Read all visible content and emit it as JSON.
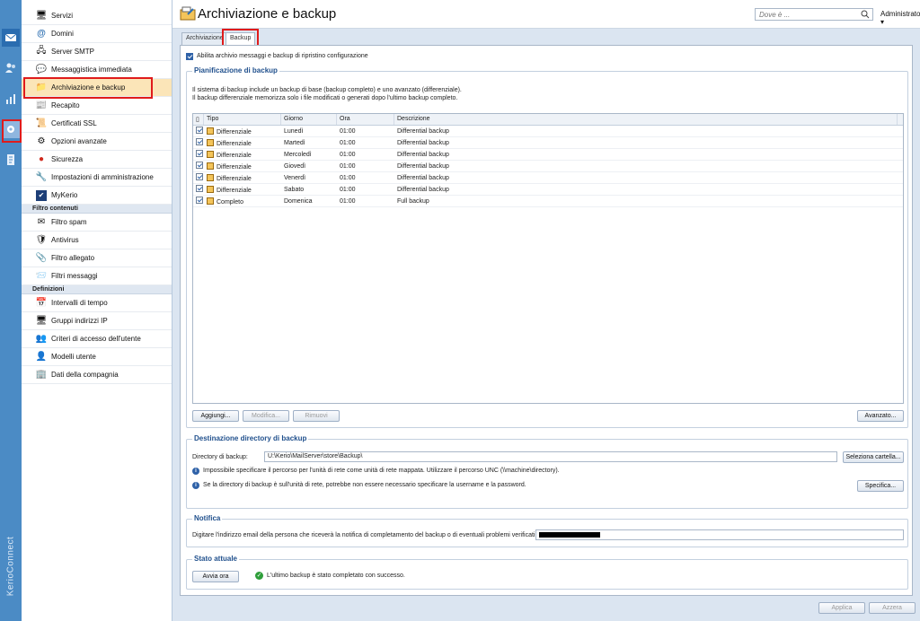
{
  "app": {
    "brand": "KerioConnect"
  },
  "rail": {
    "items": [
      {
        "name": "mail-icon"
      },
      {
        "name": "users-icon"
      },
      {
        "name": "stats-icon"
      },
      {
        "name": "config-icon"
      },
      {
        "name": "log-icon"
      }
    ]
  },
  "sidebar": {
    "items": [
      {
        "label": "Servizi",
        "icon": "services-icon"
      },
      {
        "label": "Domini",
        "icon": "at-icon"
      },
      {
        "label": "Server SMTP",
        "icon": "smtp-icon"
      },
      {
        "label": "Messaggistica immediata",
        "icon": "im-icon"
      },
      {
        "label": "Archiviazione e backup",
        "icon": "archive-icon"
      },
      {
        "label": "Recapito",
        "icon": "delivery-icon"
      },
      {
        "label": "Certificati SSL",
        "icon": "certificate-icon"
      },
      {
        "label": "Opzioni avanzate",
        "icon": "advanced-icon"
      },
      {
        "label": "Sicurezza",
        "icon": "security-icon"
      },
      {
        "label": "Impostazioni di amministrazione",
        "icon": "admin-icon"
      },
      {
        "label": "MyKerio",
        "icon": "mykerio-icon"
      }
    ],
    "section_filters": "Filtro contenuti",
    "filter_items": [
      {
        "label": "Filtro spam"
      },
      {
        "label": "Antivirus"
      },
      {
        "label": "Filtro allegato"
      },
      {
        "label": "Filtri messaggi"
      }
    ],
    "section_defs": "Definizioni",
    "def_items": [
      {
        "label": "Intervalli di tempo"
      },
      {
        "label": "Gruppi indirizzi IP"
      },
      {
        "label": "Criteri di accesso dell'utente"
      },
      {
        "label": "Modelli utente"
      },
      {
        "label": "Dati della compagnia"
      }
    ]
  },
  "header": {
    "title": "Archiviazione e backup",
    "search_placeholder": "Dove è ...",
    "user": "Administrator ▾"
  },
  "tabs": {
    "archive": "Archiviazione",
    "backup": "Backup"
  },
  "enable_label": "Abilita archivio messaggi e backup di ripristino configurazione",
  "schedule": {
    "title": "Pianificazione di backup",
    "desc1": "Il sistema di backup include un backup di base (backup completo) e uno avanzato (differenziale).",
    "desc2": "Il backup differenziale memorizza solo i file modificati o generati dopo l'ultimo backup completo.",
    "columns": [
      "Tipo",
      "Giorno",
      "Ora",
      "Descrizione"
    ],
    "rows": [
      {
        "type": "Differenziale",
        "day": "Lunedì",
        "time": "01:00",
        "desc": "Differential backup"
      },
      {
        "type": "Differenziale",
        "day": "Martedì",
        "time": "01:00",
        "desc": "Differential backup"
      },
      {
        "type": "Differenziale",
        "day": "Mercoledì",
        "time": "01:00",
        "desc": "Differential backup"
      },
      {
        "type": "Differenziale",
        "day": "Giovedì",
        "time": "01:00",
        "desc": "Differential backup"
      },
      {
        "type": "Differenziale",
        "day": "Venerdì",
        "time": "01:00",
        "desc": "Differential backup"
      },
      {
        "type": "Differenziale",
        "day": "Sabato",
        "time": "01:00",
        "desc": "Differential backup"
      },
      {
        "type": "Completo",
        "day": "Domenica",
        "time": "01:00",
        "desc": "Full backup"
      }
    ],
    "add": "Aggiungi...",
    "edit": "Modifica...",
    "remove": "Rimuovi",
    "advanced": "Avanzato..."
  },
  "destination": {
    "title": "Destinazione directory di backup",
    "dir_label": "Directory di backup:",
    "dir_value": "U:\\Kerio\\MailServer\\store\\Backup\\",
    "select_folder": "Seleziona cartella...",
    "info1": "Impossibile specificare il percorso per l'unità di rete come unità di rete mappata. Utilizzare il percorso UNC (\\\\machine\\directory).",
    "info2": "Se la directory di backup è sull'unità di rete, potrebbe non essere necessario specificare la username e la password.",
    "specify": "Specifica..."
  },
  "notify": {
    "title": "Notifica",
    "label": "Digitare l'indirizzo email della persona che riceverà la notifica di completamento del backup o di eventuali problemi verificatisi:"
  },
  "status": {
    "title": "Stato attuale",
    "start": "Avvia ora",
    "message": "L'ultimo backup è stato completato con successo."
  },
  "footer": {
    "apply": "Applica",
    "reset": "Azzera"
  }
}
